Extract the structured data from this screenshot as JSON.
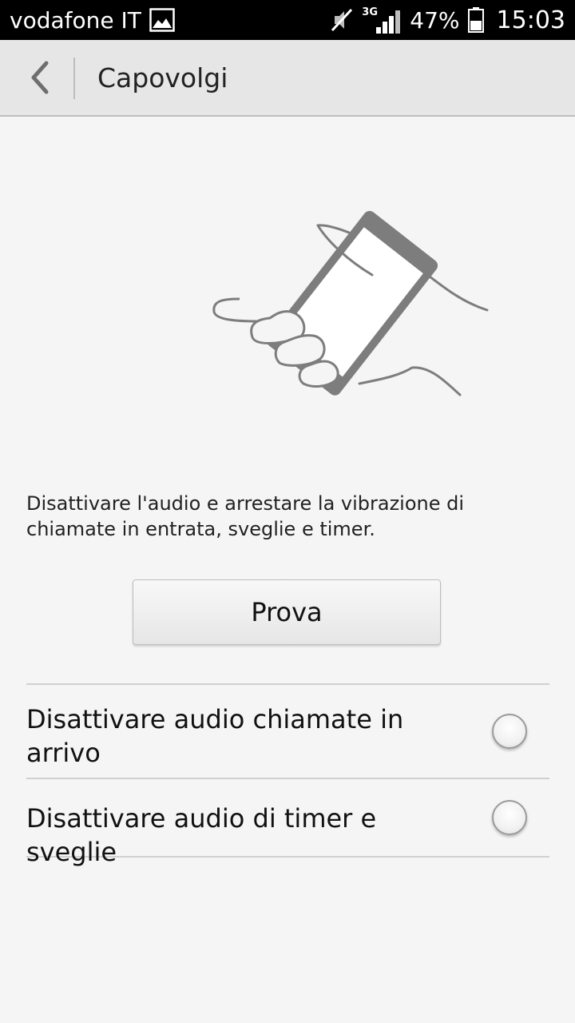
{
  "status_bar": {
    "carrier": "vodafone IT",
    "network_type": "3G",
    "battery_percent": "47%",
    "time": "15:03",
    "icons": [
      "image-icon",
      "muted-icon",
      "signal-icon",
      "battery-icon"
    ]
  },
  "header": {
    "title": "Capovolgi",
    "back_icon": "chevron-left-icon"
  },
  "main": {
    "illustration_icon": "hand-holding-phone-icon",
    "description": "Disattivare l'audio e arrestare la vibrazione di chiamate in entrata, sveglie e timer.",
    "try_button_label": "Prova"
  },
  "options": [
    {
      "label": "Disattivare audio chiamate in arrivo",
      "checked": false
    },
    {
      "label": "Disattivare audio di timer e sveglie",
      "checked": false
    }
  ],
  "colors": {
    "status_bar_bg": "#000000",
    "action_bar_bg": "#e6e6e6",
    "page_bg": "#f5f5f5",
    "illustration_gray": "#7d7d7d"
  }
}
